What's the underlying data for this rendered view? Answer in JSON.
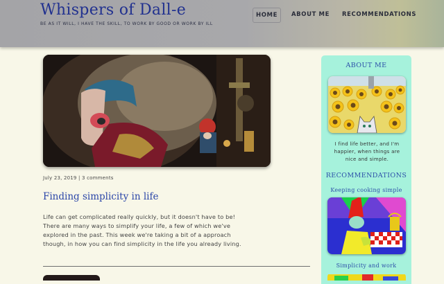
{
  "header": {
    "site_title": "Whispers of Dall-e",
    "tagline": "BE AS IT WILL, I HAVE THE SKILL, TO WORK BY GOOD OR WORK BY ILL",
    "nav": [
      {
        "label": "HOME",
        "active": true
      },
      {
        "label": "ABOUT ME",
        "active": false
      },
      {
        "label": "RECOMMENDATIONS",
        "active": false
      }
    ]
  },
  "post": {
    "date": "July 23, 2019",
    "separator": "|",
    "comments": "3 comments",
    "title": "Finding simplicity in life",
    "excerpt": "Life can get complicated really quickly, but it doesn't have to be! There are many ways to simplify your life, a few of which we've explored in the past. This week we're taking a bit of a approach though, in how you can find simplicity in the life you already living."
  },
  "sidebar": {
    "about_title": "ABOUT ME",
    "about_text": "I find life better, and I'm happier, when things are nice and simple.",
    "recommendations_title": "RECOMMENDATIONS",
    "recommendations": [
      {
        "label": "Keeping cooking simple"
      },
      {
        "label": "Simplicity and work"
      }
    ]
  },
  "colors": {
    "title_blue": "#21318f",
    "link_blue": "#2a45a8",
    "sidebar_bg": "#a6f2dc",
    "page_bg": "#f8f7e8"
  }
}
